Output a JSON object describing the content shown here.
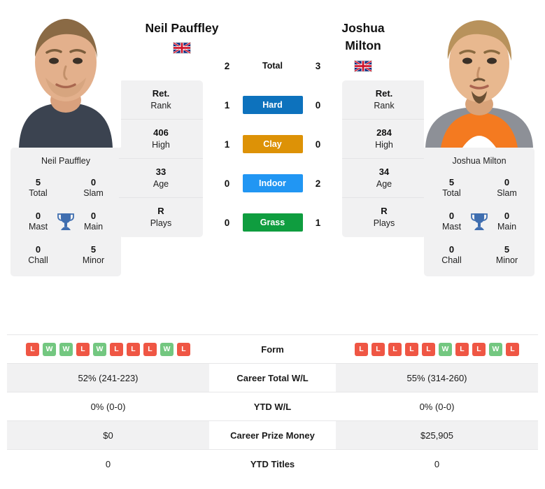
{
  "players": {
    "left": {
      "name": "Neil Pauffley",
      "name_lines": [
        "Neil Pauffley"
      ],
      "country_flag": "gb-flag-icon",
      "card_name": "Neil Pauffley",
      "titles": {
        "total": "5",
        "total_label": "Total",
        "slam": "0",
        "slam_label": "Slam",
        "mast": "0",
        "mast_label": "Mast",
        "main": "0",
        "main_label": "Main",
        "chall": "0",
        "chall_label": "Chall",
        "minor": "5",
        "minor_label": "Minor"
      },
      "rank": {
        "value": "Ret.",
        "label": "Rank"
      },
      "high": {
        "value": "406",
        "label": "High"
      },
      "age": {
        "value": "33",
        "label": "Age"
      },
      "plays": {
        "value": "R",
        "label": "Plays"
      },
      "form": [
        "L",
        "W",
        "W",
        "L",
        "W",
        "L",
        "L",
        "L",
        "W",
        "L"
      ],
      "career_total_wl": "52% (241-223)",
      "ytd_wl": "0% (0-0)",
      "career_prize_money": "$0",
      "ytd_titles": "0"
    },
    "right": {
      "name": "Joshua Milton",
      "name_lines": [
        "Joshua",
        "Milton"
      ],
      "country_flag": "gb-flag-icon",
      "card_name": "Joshua Milton",
      "titles": {
        "total": "5",
        "total_label": "Total",
        "slam": "0",
        "slam_label": "Slam",
        "mast": "0",
        "mast_label": "Mast",
        "main": "0",
        "main_label": "Main",
        "chall": "0",
        "chall_label": "Chall",
        "minor": "5",
        "minor_label": "Minor"
      },
      "rank": {
        "value": "Ret.",
        "label": "Rank"
      },
      "high": {
        "value": "284",
        "label": "High"
      },
      "age": {
        "value": "34",
        "label": "Age"
      },
      "plays": {
        "value": "R",
        "label": "Plays"
      },
      "form": [
        "L",
        "L",
        "L",
        "L",
        "L",
        "W",
        "L",
        "L",
        "W",
        "L"
      ],
      "career_total_wl": "55% (314-260)",
      "ytd_wl": "0% (0-0)",
      "career_prize_money": "$25,905",
      "ytd_titles": "0"
    }
  },
  "head_to_head": {
    "total": {
      "label": "Total",
      "left": "2",
      "right": "3"
    },
    "surfaces": [
      {
        "label": "Hard",
        "left": "1",
        "right": "0",
        "color": "#0d72bd"
      },
      {
        "label": "Clay",
        "left": "1",
        "right": "0",
        "color": "#dd9206"
      },
      {
        "label": "Indoor",
        "left": "0",
        "right": "2",
        "color": "#2196f3"
      },
      {
        "label": "Grass",
        "left": "0",
        "right": "1",
        "color": "#0f9d3f"
      }
    ]
  },
  "comparison_rows": [
    {
      "label": "Form",
      "left": "",
      "right": "",
      "type": "form",
      "shaded": false
    },
    {
      "label": "Career Total W/L",
      "left": "52% (241-223)",
      "right": "55% (314-260)",
      "type": "text",
      "shaded": true
    },
    {
      "label": "YTD W/L",
      "left": "0% (0-0)",
      "right": "0% (0-0)",
      "type": "text",
      "shaded": false
    },
    {
      "label": "Career Prize Money",
      "left": "$0",
      "right": "$25,905",
      "type": "text",
      "shaded": true
    },
    {
      "label": "YTD Titles",
      "left": "0",
      "right": "0",
      "type": "text",
      "shaded": false
    }
  ],
  "colors": {
    "card_bg": "#f1f1f2",
    "win": "#73c780",
    "loss": "#ef5644",
    "trophy": "#3f6eb0"
  }
}
